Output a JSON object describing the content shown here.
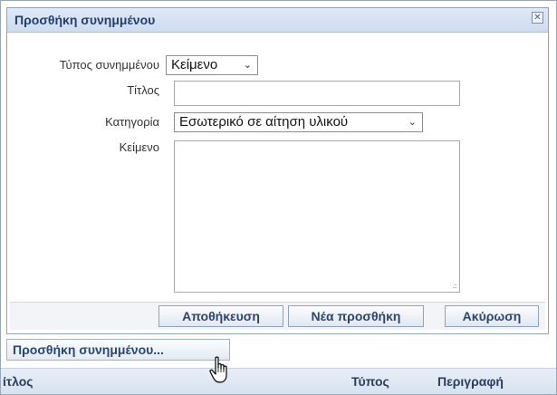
{
  "dialog": {
    "title": "Προσθήκη συνημμένου",
    "close_glyph": "✕",
    "fields": {
      "type": {
        "label": "Τύπος συνημμένου",
        "value": "Κείμενο"
      },
      "title": {
        "label": "Τίτλος",
        "value": ""
      },
      "category": {
        "label": "Κατηγορία",
        "value": "Εσωτερικό σε αίτηση υλικού"
      },
      "text": {
        "label": "Κείμενο",
        "value": ""
      }
    },
    "buttons": {
      "save": "Αποθήκευση",
      "new": "Νέα προσθήκη",
      "cancel": "Ακύρωση"
    }
  },
  "add_attachment_button": "Προσθήκη συνημμένου...",
  "grid": {
    "columns": [
      "ίτλος",
      "Τύπος",
      "Περιγραφή"
    ]
  },
  "icons": {
    "dropdown": "chevron-down-icon",
    "close": "close-icon",
    "cursor": "hand-pointer-icon"
  },
  "colors": {
    "header_bg": "#d7e2f1",
    "button_text": "#2a4670",
    "title_text": "#23406b"
  }
}
